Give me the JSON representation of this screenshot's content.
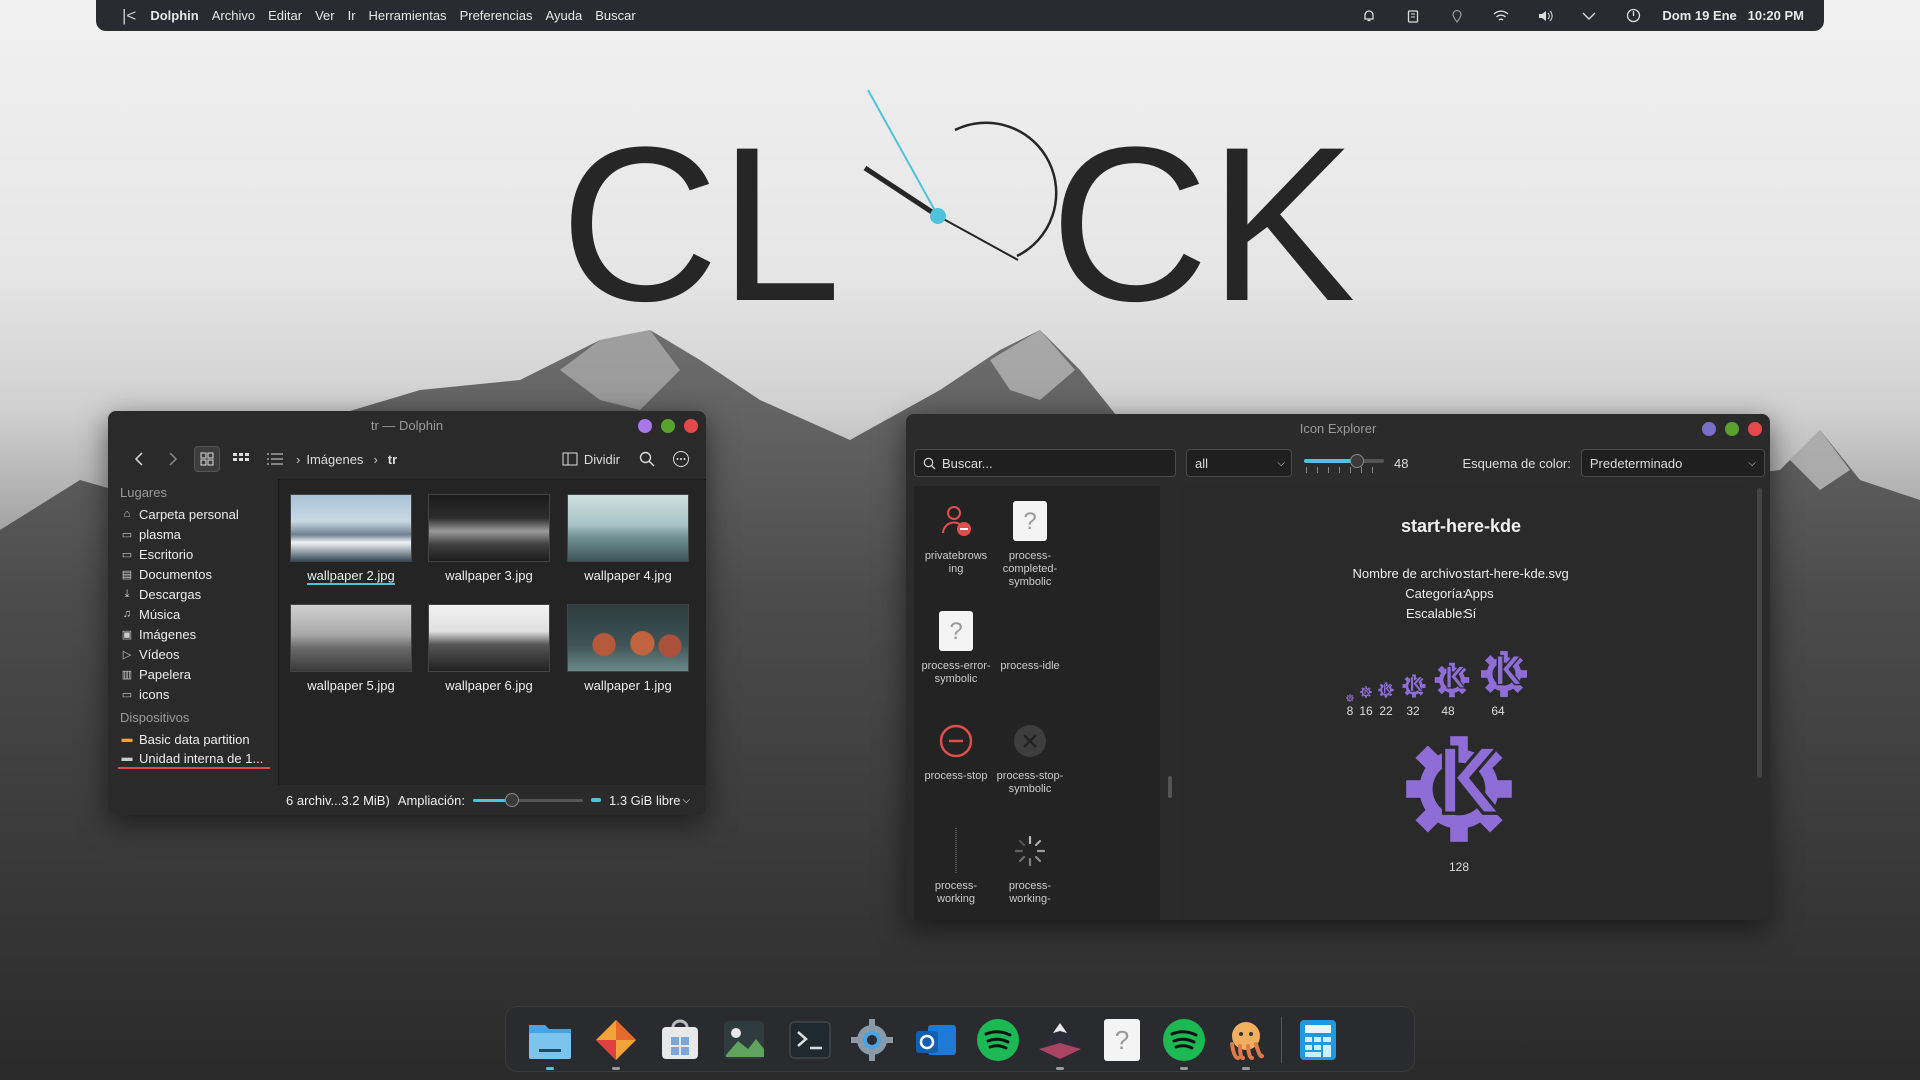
{
  "topbar": {
    "app": "Dolphin",
    "menu": [
      "Archivo",
      "Editar",
      "Ver",
      "Ir",
      "Herramientas",
      "Preferencias",
      "Ayuda",
      "Buscar"
    ],
    "tray_icons": [
      "bell-icon",
      "clipboard-icon",
      "location-icon",
      "wifi-icon",
      "volume-icon",
      "chevron-down-icon",
      "power-icon"
    ],
    "datetime": "Dom 19 Ene   10:20 PM"
  },
  "wallpaper": {
    "clock_letters_left": "CL",
    "clock_letters_right": "CK"
  },
  "dolphin": {
    "title": "tr — Dolphin",
    "breadcrumb": [
      "Imágenes",
      "tr"
    ],
    "split_label": "Dividir",
    "places_header": "Lugares",
    "places": [
      {
        "icon": "home-icon",
        "label": "Carpeta personal"
      },
      {
        "icon": "folder-icon",
        "label": "plasma"
      },
      {
        "icon": "desktop-icon",
        "label": "Escritorio"
      },
      {
        "icon": "document-icon",
        "label": "Documentos"
      },
      {
        "icon": "download-icon",
        "label": "Descargas"
      },
      {
        "icon": "music-icon",
        "label": "Música"
      },
      {
        "icon": "image-icon",
        "label": "Imágenes"
      },
      {
        "icon": "video-icon",
        "label": "Vídeos"
      },
      {
        "icon": "trash-icon",
        "label": "Papelera"
      },
      {
        "icon": "folder-icon",
        "label": "icons"
      }
    ],
    "devices_header": "Dispositivos",
    "devices": [
      {
        "icon": "drive-icon",
        "label": "Basic data partition"
      },
      {
        "icon": "drive-icon",
        "label": "Unidad interna de 1..."
      }
    ],
    "files": [
      {
        "name": "wallpaper 2.jpg",
        "selected": true
      },
      {
        "name": "wallpaper 3.jpg"
      },
      {
        "name": "wallpaper 4.jpg"
      },
      {
        "name": "wallpaper 5.jpg"
      },
      {
        "name": "wallpaper 6.jpg"
      },
      {
        "name": "wallpaper 1.jpg"
      }
    ],
    "status": {
      "summary": "6 archiv...3.2 MiB)",
      "zoom_label": "Ampliación:",
      "zoom_level": 0.35,
      "free_space": "1.3 GiB libre"
    }
  },
  "icon_explorer": {
    "title": "Icon Explorer",
    "search_placeholder": "Buscar...",
    "filter_value": "all",
    "size_value": "48",
    "scheme_label": "Esquema de color:",
    "scheme_value": "Predeterminado",
    "icons": [
      {
        "name": "privatebrows ing"
      },
      {
        "name": "process-completed-symbolic"
      },
      {
        "name": "process-error-symbolic"
      },
      {
        "name": "process-idle"
      },
      {
        "name": "process-stop"
      },
      {
        "name": "process-stop-symbolic"
      },
      {
        "name": "process-working"
      },
      {
        "name": "process-working-"
      }
    ],
    "detail": {
      "name": "start-here-kde",
      "filename_label": "Nombre de archivo:",
      "filename": "start-here-kde.svg",
      "category_label": "Categoría:",
      "category": "Apps",
      "scalable_label": "Escalable:",
      "scalable": "Sí",
      "sizes": [
        "8",
        "16",
        "22",
        "32",
        "48",
        "64",
        "128"
      ],
      "accent": "#8e6dd6"
    }
  },
  "dock": {
    "apps": [
      "files-icon",
      "firefox-icon",
      "store-icon",
      "image-viewer-icon",
      "terminal-icon",
      "settings-icon",
      "outlook-icon",
      "spotify-icon",
      "mountain-app-icon",
      "unknown-icon",
      "spotify-icon",
      "octopus-icon",
      "calculator-icon"
    ]
  },
  "colors": {
    "close": "#e54a4a",
    "maximize": "#5aa02c",
    "minimize": "#a977e8",
    "clock_hand": "#4fc3d9"
  }
}
